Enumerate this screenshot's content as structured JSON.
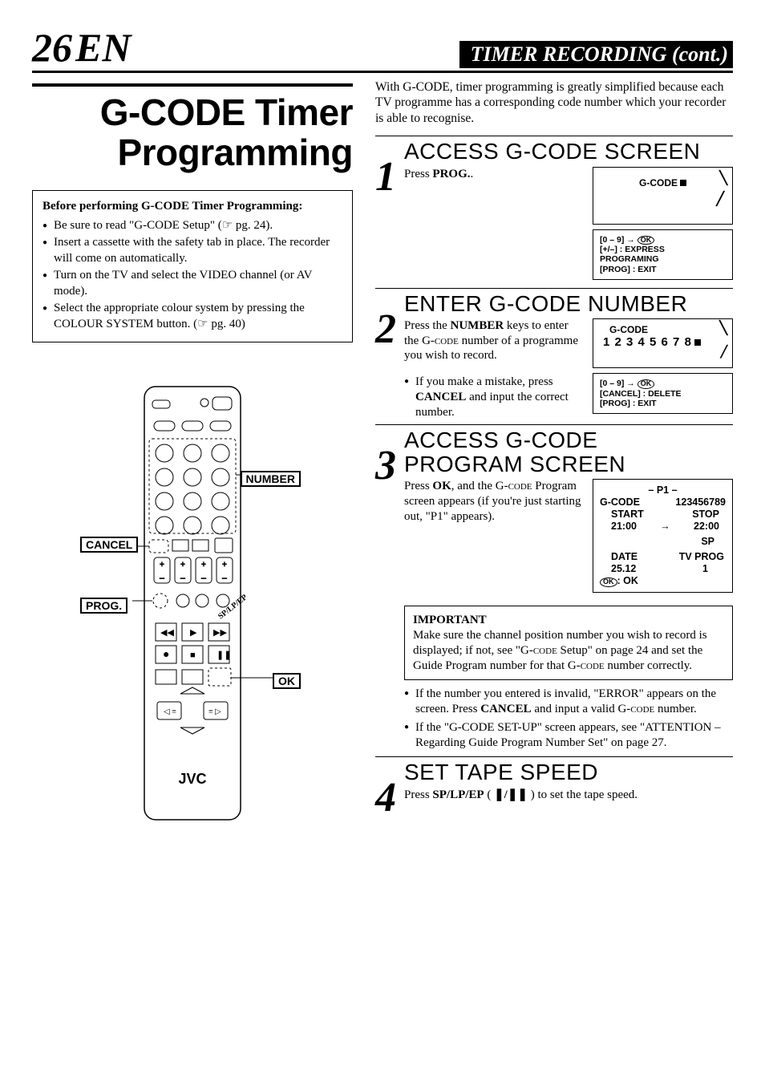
{
  "page": {
    "num": "26",
    "lang": "EN",
    "header": "TIMER RECORDING (cont.)"
  },
  "title": {
    "l1": "G-CODE Timer",
    "l2": "Programming"
  },
  "before": {
    "heading": "Before performing G-CODE Timer Programming:",
    "b1": "Be sure to read \"G-CODE Setup\" (☞ pg. 24).",
    "b2": "Insert a cassette with the safety tab in place. The recorder will come on automatically.",
    "b3": "Turn on the TV and select the VIDEO channel (or AV mode).",
    "b4": "Select the appropriate colour system by pressing the COLOUR SYSTEM button. (☞ pg. 40)"
  },
  "labels": {
    "number": "NUMBER",
    "cancel": "CANCEL",
    "prog": "PROG.",
    "ok": "OK"
  },
  "brand": "JVC",
  "intro": "With G-CODE, timer programming is greatly simplified because each TV programme has a corresponding code number which your recorder is able to recognise.",
  "step1": {
    "title": "ACCESS G-CODE SCREEN",
    "body": "Press PROG..",
    "screen1": {
      "t": "G-CODE"
    },
    "screen2": {
      "l1": "[0 – 9] →",
      "l2": "[+/–] : EXPRESS PROGRAMING",
      "l3": "[PROG] : EXIT"
    }
  },
  "step2": {
    "title": "ENTER G-CODE NUMBER",
    "body": "Press the NUMBER keys to enter the G-CODE number of a programme you wish to record.",
    "note": "If you make a mistake, press CANCEL and input the correct number.",
    "screen1": {
      "t": "G-CODE",
      "n": "1 2 3 4 5 6 7 8"
    },
    "screen2": {
      "l1": "[0 – 9] →",
      "l2": "[CANCEL] : DELETE",
      "l3": "[PROG] : EXIT"
    }
  },
  "step3": {
    "title": "ACCESS G-CODE PROGRAM SCREEN",
    "body": "Press OK, and the G-CODE Program screen appears (if you're just starting out, \"P1\" appears).",
    "screen": {
      "p": "– P1 –",
      "gcode": "G-CODE",
      "gnum": "123456789",
      "start_l": "START",
      "start": "21:00",
      "stop_l": "STOP",
      "stop": "22:00",
      "sp": "SP",
      "date_l": "DATE",
      "date": "25.12",
      "tvp_l": "TV PROG",
      "tvp": "1",
      "okl": "OK"
    },
    "important": {
      "h": "IMPORTANT",
      "t": "Make sure the channel position number you wish to record is displayed; if not, see \"G-CODE Setup\" on page 24 and set the Guide Program number for that G-CODE number correctly."
    },
    "n1": "If the number you entered is invalid, \"ERROR\" appears on the screen. Press CANCEL and input a valid G-CODE number.",
    "n2": "If the \"G-CODE SET-UP\" screen appears, see \"ATTENTION – Regarding Guide Program Number Set\" on page 27."
  },
  "step4": {
    "title": "SET TAPE SPEED",
    "body": "Press SP/LP/EP ( ❚/❚❚ ) to set the tape speed."
  }
}
